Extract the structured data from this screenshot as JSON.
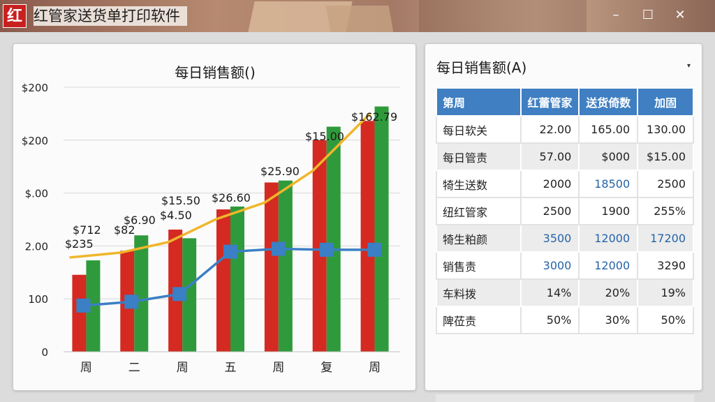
{
  "app": {
    "logo_char": "红",
    "title": "红管家送货单打印软件",
    "min_icon": "–",
    "max_icon": "☐",
    "close_icon": "✕"
  },
  "chart_data": {
    "type": "bar",
    "title": "每日销售额()",
    "categories": [
      "周",
      "二",
      "周",
      "五",
      "周",
      "复",
      "周"
    ],
    "y_tick_labels": [
      "0",
      "100",
      "2.00",
      "$.00",
      "$200",
      "$200"
    ],
    "ylim": [
      0,
      275
    ],
    "grid": true,
    "series": [
      {
        "color": "#d42a22",
        "values": [
          80,
          105,
          127,
          148,
          176,
          220,
          240
        ]
      },
      {
        "color": "#2f9a3c",
        "values": [
          95,
          121,
          118,
          151,
          178,
          234,
          255
        ]
      },
      {
        "type": "line",
        "color": "#3b7fc4",
        "values": [
          48,
          52,
          60,
          104,
          107,
          106,
          106
        ]
      },
      {
        "type": "line",
        "color": "#f0b62a",
        "values": [
          98,
          103,
          114,
          138,
          155,
          188,
          248
        ]
      }
    ],
    "annotations": [
      "$235",
      "$712",
      "$82",
      "$6.90",
      "$15.50",
      "$4.50",
      "$26.60",
      "$25.90",
      "$15.00",
      "$162.79"
    ]
  },
  "table": {
    "title": "每日销售额(A)",
    "dropdown_icon": "▾",
    "headers": [
      "第周",
      "红蕾管家",
      "送货倚数",
      "加固"
    ],
    "rows": [
      {
        "label": "每日软关",
        "c1": "22.00",
        "c2": "165.00",
        "c3": "130.00"
      },
      {
        "label": "每日管责",
        "c1": "57.00",
        "c2": "$000",
        "c3": "$15.00"
      },
      {
        "label": "犄生送数",
        "c1": "2000",
        "c2": "18500",
        "c3": "2500"
      },
      {
        "label": "纽红管家",
        "c1": "2500",
        "c2": "1900",
        "c3": "255%"
      },
      {
        "label": "犄生粕颜",
        "c1": "3500",
        "c2": "12000",
        "c3": "17200"
      },
      {
        "label": "销售责",
        "c1": "3000",
        "c2": "12000",
        "c3": "3290"
      },
      {
        "label": "车料拨",
        "c1": "14%",
        "c2": "20%",
        "c3": "19%"
      },
      {
        "label": "陴莅责",
        "c1": "50%",
        "c2": "30%",
        "c3": "50%"
      }
    ]
  }
}
